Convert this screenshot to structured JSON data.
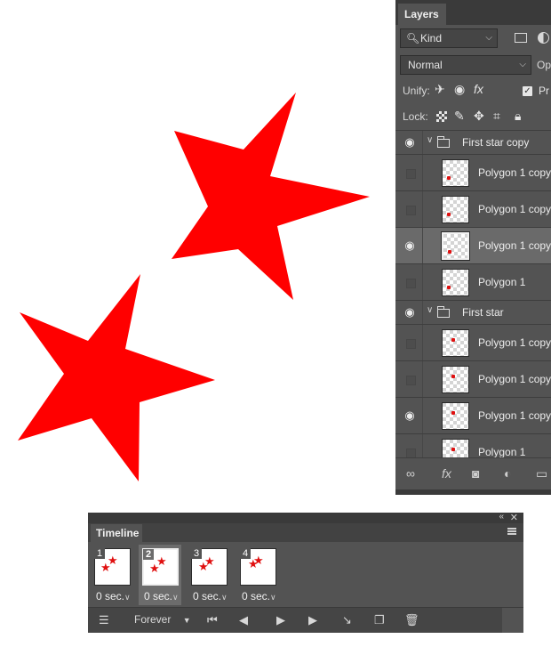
{
  "layers_panel": {
    "tab_label": "Layers",
    "kind_filter": {
      "value": "Kind"
    },
    "blend_mode": {
      "value": "Normal"
    },
    "opacity_label": "Op",
    "unify_label": "Unify:",
    "propagate_label": "Pr",
    "lock_label": "Lock:",
    "items": [
      {
        "type": "group",
        "name": "First star copy",
        "visible": true
      },
      {
        "type": "layer",
        "name": "Polygon 1 copy",
        "visible": false,
        "selected": false
      },
      {
        "type": "layer",
        "name": "Polygon 1 copy",
        "visible": false,
        "selected": false
      },
      {
        "type": "layer",
        "name": "Polygon 1 copy",
        "visible": true,
        "selected": true
      },
      {
        "type": "layer",
        "name": "Polygon 1",
        "visible": false,
        "selected": false
      },
      {
        "type": "group",
        "name": "First star",
        "visible": true
      },
      {
        "type": "layer",
        "name": "Polygon 1 copy",
        "visible": false,
        "selected": false
      },
      {
        "type": "layer",
        "name": "Polygon 1 copy",
        "visible": false,
        "selected": false
      },
      {
        "type": "layer",
        "name": "Polygon 1 copy",
        "visible": true,
        "selected": false
      },
      {
        "type": "layer",
        "name": "Polygon 1",
        "visible": false,
        "selected": false
      }
    ],
    "bottom_icons": [
      "link-icon",
      "fx-icon",
      "mask-icon",
      "adjustment-icon",
      "folder-icon"
    ],
    "fx_label": "fx"
  },
  "timeline": {
    "tab_label": "Timeline",
    "frames": [
      {
        "number": "1",
        "delay": "0 sec.",
        "selected": false
      },
      {
        "number": "2",
        "delay": "0 sec.",
        "selected": true
      },
      {
        "number": "3",
        "delay": "0 sec.",
        "selected": false
      },
      {
        "number": "4",
        "delay": "0 sec.",
        "selected": false
      }
    ],
    "loop": "Forever"
  },
  "colors": {
    "star": "#ff0000",
    "panel_bg": "#535353",
    "selected_row": "#6a6a6a"
  }
}
